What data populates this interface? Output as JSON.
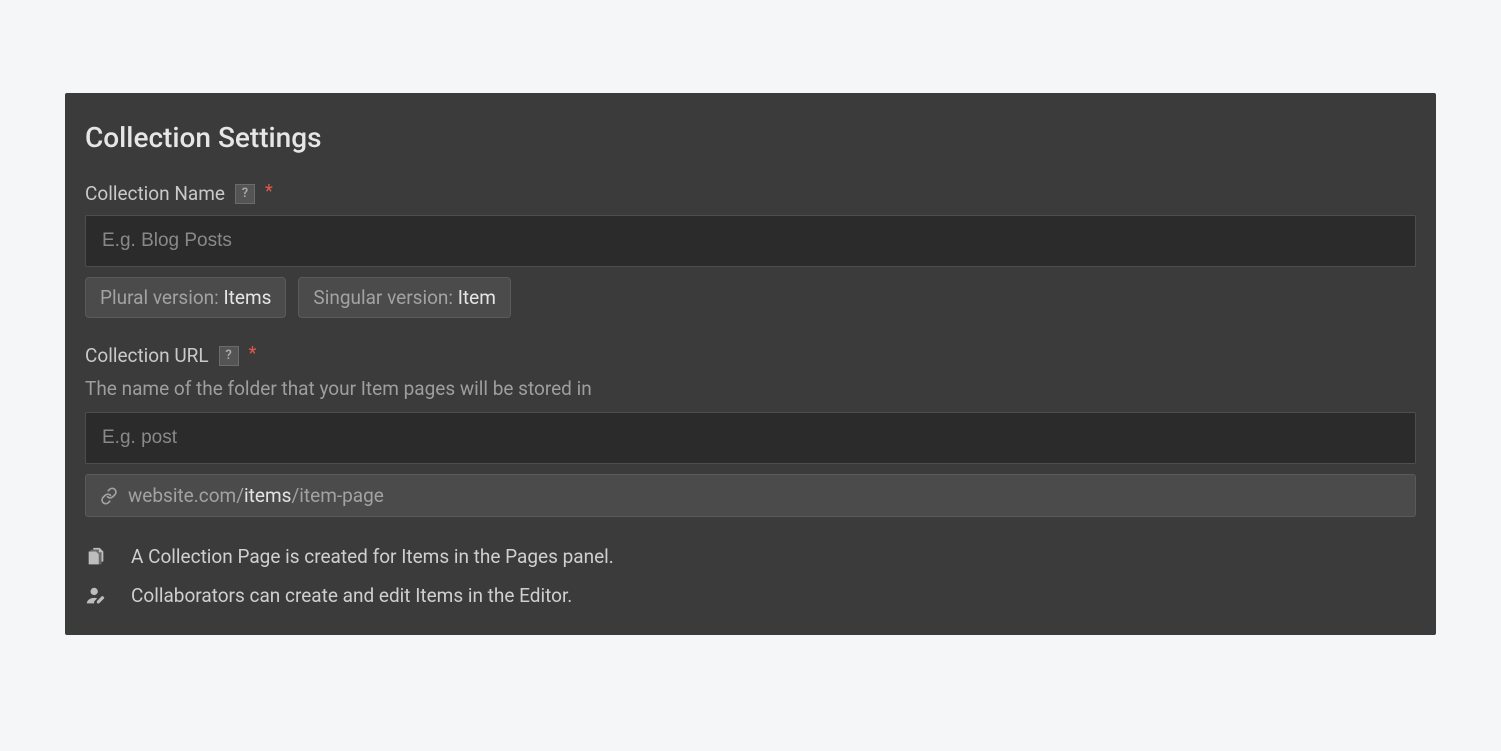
{
  "title": "Collection Settings",
  "collection_name": {
    "label": "Collection Name",
    "placeholder": "E.g. Blog Posts",
    "help_glyph": "?",
    "required_glyph": "*",
    "plural": {
      "prefix": "Plural version: ",
      "value": "Items"
    },
    "singular": {
      "prefix": "Singular version: ",
      "value": "Item"
    }
  },
  "collection_url": {
    "label": "Collection URL",
    "help_glyph": "?",
    "required_glyph": "*",
    "hint": "The name of the folder that your Item pages will be stored in",
    "placeholder": "E.g. post",
    "preview": {
      "host": "website.com/",
      "slug": "items",
      "suffix": "/item-page"
    }
  },
  "notes": [
    "A Collection Page is created for Items in the Pages panel.",
    "Collaborators can create and edit Items in the Editor."
  ]
}
